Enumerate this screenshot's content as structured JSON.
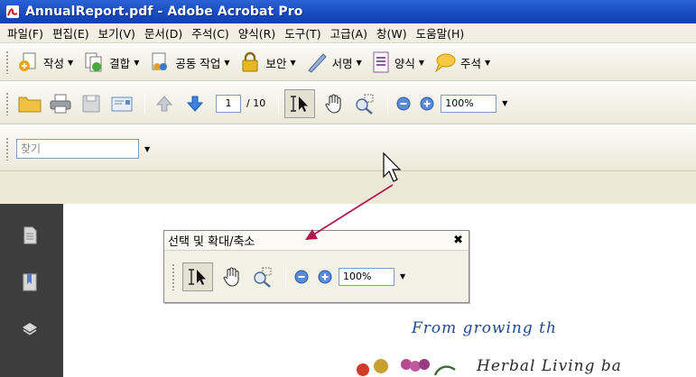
{
  "window": {
    "title": "AnnualReport.pdf - Adobe Acrobat Pro"
  },
  "menubar": {
    "items": [
      "파일(F)",
      "편집(E)",
      "보기(V)",
      "문서(D)",
      "주석(C)",
      "양식(R)",
      "도구(T)",
      "고급(A)",
      "창(W)",
      "도움말(H)"
    ]
  },
  "tasks": {
    "create": "작성",
    "combine": "결합",
    "collaborate": "공동 작업",
    "secure": "보안",
    "sign": "서명",
    "forms": "양식",
    "comment": "주석"
  },
  "navigation": {
    "current_page": "1",
    "total_pages": "/ 10",
    "zoom": "100%"
  },
  "find": {
    "placeholder": "찾기"
  },
  "floating_toolbar": {
    "title": "선택 및 확대/축소",
    "zoom": "100%"
  },
  "document": {
    "line1": "From growing th",
    "line2": "Herbal Living ba"
  },
  "colors": {
    "titlebar": "#1b4fc4",
    "navpane": "#3d3d3d",
    "doc_text": "#1e4a8f",
    "arrow": "#b01850"
  }
}
